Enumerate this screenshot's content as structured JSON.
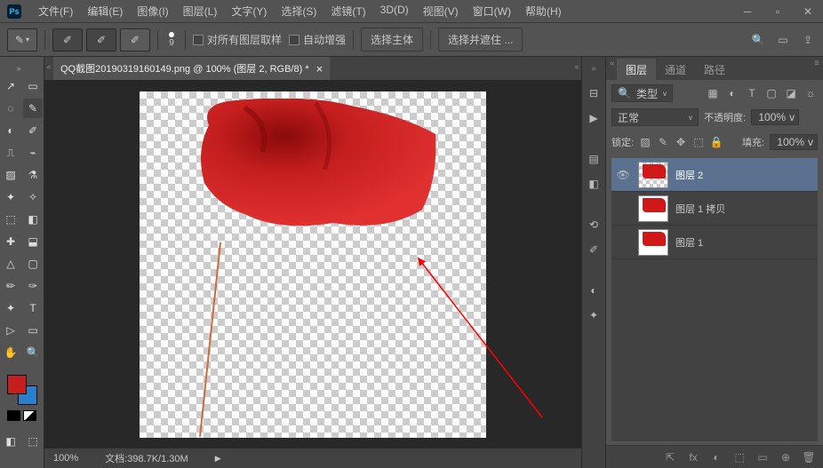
{
  "menu": [
    "文件(F)",
    "编辑(E)",
    "图像(I)",
    "图层(L)",
    "文字(Y)",
    "选择(S)",
    "滤镜(T)",
    "3D(D)",
    "视图(V)",
    "窗口(W)",
    "帮助(H)"
  ],
  "options_bar": {
    "brush_size": "9",
    "sample_all_label": "对所有图层取样",
    "auto_enhance_label": "自动增强",
    "select_subject": "选择主体",
    "select_and_mask": "选择并遮住 ..."
  },
  "document": {
    "tab_title": "QQ截图20190319160149.png @ 100% (图层 2, RGB/8) *",
    "zoom": "100%",
    "doc_info": "文档:398.7K/1.30M"
  },
  "colors": {
    "foreground": "#c41e1e",
    "background": "#2a7fcc"
  },
  "panels": {
    "tabs": {
      "layers": "图层",
      "channels": "通道",
      "paths": "路径"
    },
    "filter_label": "类型",
    "blend_mode": "正常",
    "opacity_label": "不透明度:",
    "opacity_value": "100%",
    "lock_label": "锁定:",
    "fill_label": "填充:",
    "fill_value": "100%",
    "layers": [
      {
        "name": "图层 2",
        "visible": true,
        "selected": true,
        "transparent_bg": true
      },
      {
        "name": "图层 1 拷贝",
        "visible": false,
        "selected": false,
        "transparent_bg": false
      },
      {
        "name": "图层 1",
        "visible": false,
        "selected": false,
        "transparent_bg": false
      }
    ]
  },
  "tool_icons": [
    "↗",
    "▭",
    "◌",
    "✎",
    "◐",
    "✐",
    "⎍",
    "⌁",
    "▨",
    "⚗",
    "✦",
    "✧",
    "⬚",
    "◧",
    "✚",
    "⬓",
    "△",
    "▢",
    "✏",
    "✑",
    "✦",
    "T",
    "▷",
    "▭",
    "✋",
    "🔍"
  ],
  "mid_icons": [
    "⊟",
    "▶",
    " ",
    "▤",
    "◧",
    " ",
    "⟲",
    "✐",
    " ",
    "◐",
    "✦"
  ],
  "filter_icons": [
    "▦",
    "◐",
    "T",
    "▢",
    "◪",
    "☼"
  ],
  "lock_icons": [
    "▨",
    "✎",
    "✥",
    "⬚",
    "🔒"
  ],
  "footer_icons": [
    "⇱",
    "fx",
    "◐",
    "⬚",
    "▭",
    "⊕",
    "🗑"
  ]
}
